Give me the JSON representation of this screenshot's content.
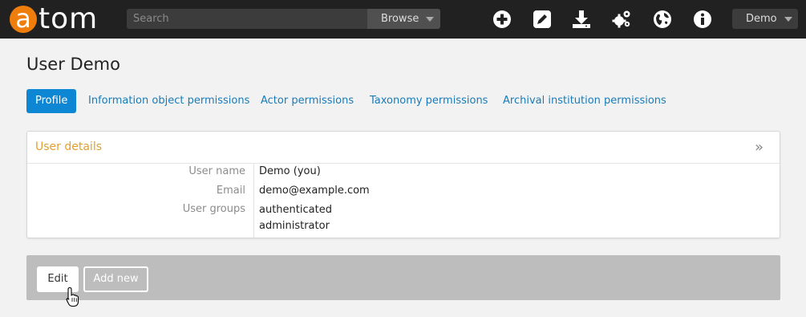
{
  "brand": {
    "logo_letter": "a",
    "logo_rest": "tom",
    "accent": "#ef7d0b"
  },
  "header": {
    "search_placeholder": "Search",
    "browse_label": "Browse",
    "icons": [
      "plus-circle-icon",
      "edit-icon",
      "download-icon",
      "settings-cogs-icon",
      "globe-icon",
      "info-icon"
    ],
    "user_menu_label": "Demo"
  },
  "page": {
    "title": "User Demo"
  },
  "tabs": [
    {
      "label": "Profile",
      "active": true
    },
    {
      "label": "Information object permissions"
    },
    {
      "label": "Actor permissions"
    },
    {
      "label": "Taxonomy permissions"
    },
    {
      "label": "Archival institution permissions"
    }
  ],
  "user_details": {
    "heading": "User details",
    "toggle": "»",
    "fields": [
      {
        "label": "User name",
        "values": [
          "Demo (you)"
        ]
      },
      {
        "label": "Email",
        "values": [
          "demo@example.com"
        ]
      },
      {
        "label": "User groups",
        "values": [
          "authenticated",
          "administrator"
        ]
      }
    ]
  },
  "actions": {
    "edit_label": "Edit",
    "add_new_label": "Add new"
  },
  "colors": {
    "link": "#1a7bb8",
    "active_tab": "#0d86d3",
    "panel_heading": "#e3a02e",
    "topbar": "#212121"
  }
}
